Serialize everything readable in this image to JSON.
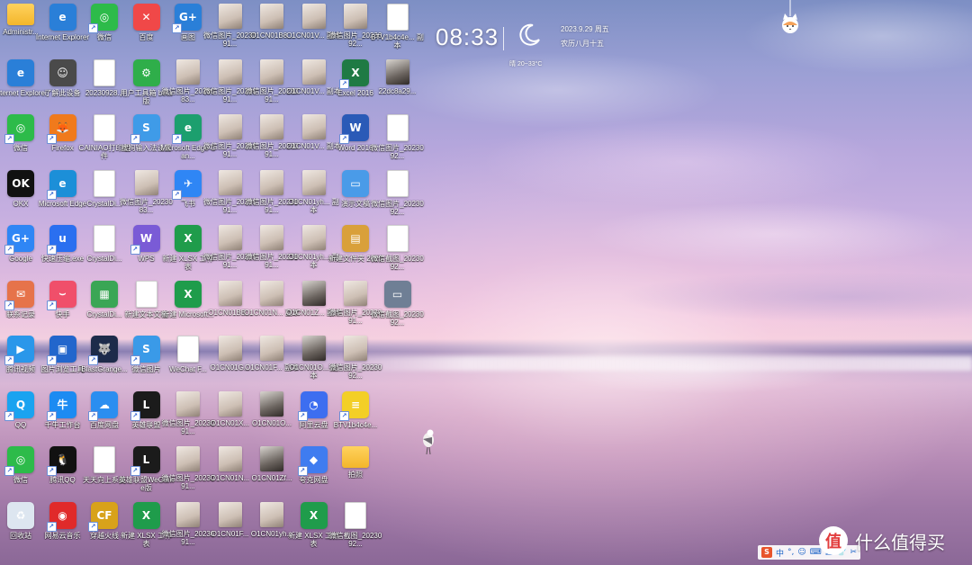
{
  "widget": {
    "time": "08:33",
    "date": "2023.9.29  周五",
    "lunar": "农历八月十五",
    "weather": "晴 20~33°C"
  },
  "brand": {
    "logo_glyph": "值",
    "text": "什么值得买"
  },
  "ime": {
    "logo": "S",
    "items": [
      "中",
      "°,",
      "☺",
      "⌨",
      "▤",
      "👕",
      "✂"
    ]
  },
  "icon_colors": {
    "blue": "#2f7de1",
    "green": "#1f9c4b",
    "red": "#e23c3c",
    "purple": "#7b4fd6",
    "orange": "#f08a24",
    "teal": "#17a5b8",
    "dark": "#2a2a2a",
    "pink": "#ef4f7d"
  },
  "columns": [
    [
      {
        "label": "Administr...",
        "kind": "folder",
        "color": "",
        "glyph": "",
        "shortcut": false
      },
      {
        "label": "Internet Explorer",
        "kind": "app",
        "color": "#2a7fd8",
        "glyph": "e",
        "shortcut": false
      },
      {
        "label": "微信",
        "kind": "app",
        "color": "#2dbb4a",
        "glyph": "◎",
        "shortcut": true
      },
      {
        "label": "OKX",
        "kind": "app",
        "color": "#111111",
        "glyph": "OK",
        "shortcut": false
      },
      {
        "label": "Google",
        "kind": "app",
        "color": "#2f86f5",
        "glyph": "G+",
        "shortcut": true
      },
      {
        "label": "联系记录",
        "kind": "app",
        "color": "#e6734a",
        "glyph": "✉",
        "shortcut": true
      },
      {
        "label": "腾讯视频",
        "kind": "app",
        "color": "#2a97ea",
        "glyph": "▶",
        "shortcut": true
      },
      {
        "label": "QQ",
        "kind": "app",
        "color": "#1aa3f0",
        "glyph": "Q",
        "shortcut": true
      },
      {
        "label": "微信",
        "kind": "app",
        "color": "#2dbb4a",
        "glyph": "◎",
        "shortcut": true
      },
      {
        "label": "回收站",
        "kind": "app",
        "color": "#dde6f0",
        "glyph": "♻",
        "shortcut": false
      }
    ],
    [
      {
        "label": "Internet Explorer",
        "kind": "app",
        "color": "#2a7fd8",
        "glyph": "e",
        "shortcut": false
      },
      {
        "label": "了解此设备",
        "kind": "app",
        "color": "#4a4a4a",
        "glyph": "☺",
        "shortcut": false
      },
      {
        "label": "Firefox",
        "kind": "app",
        "color": "#f07a1c",
        "glyph": "🦊",
        "shortcut": true
      },
      {
        "label": "Microsoft Edge",
        "kind": "app",
        "color": "#1c8fd8",
        "glyph": "e",
        "shortcut": true
      },
      {
        "label": "快速压缩.exe",
        "kind": "app",
        "color": "#2a6ff0",
        "glyph": "u",
        "shortcut": true
      },
      {
        "label": "快手",
        "kind": "app",
        "color": "#f04f6a",
        "glyph": "⌣",
        "shortcut": true
      },
      {
        "label": "图片浏览工具",
        "kind": "app",
        "color": "#2266cc",
        "glyph": "▣",
        "shortcut": true
      },
      {
        "label": "千牛工作台",
        "kind": "app",
        "color": "#1c8bf2",
        "glyph": "牛",
        "shortcut": true
      },
      {
        "label": "腾讯QQ",
        "kind": "app",
        "color": "#111111",
        "glyph": "🐧",
        "shortcut": true
      },
      {
        "label": "网易云音乐",
        "kind": "app",
        "color": "#e02a2a",
        "glyph": "◉",
        "shortcut": true
      }
    ],
    [
      {
        "label": "微信",
        "kind": "app",
        "color": "#2dbb4a",
        "glyph": "◎",
        "shortcut": true
      },
      {
        "label": "20230928...",
        "kind": "doc",
        "color": "",
        "glyph": "",
        "shortcut": false
      },
      {
        "label": "CAINIAO打印组件",
        "kind": "doc",
        "color": "",
        "glyph": "",
        "shortcut": false
      },
      {
        "label": "CrystalDi...",
        "kind": "doc",
        "color": "",
        "glyph": "",
        "shortcut": false
      },
      {
        "label": "CrystalDi...",
        "kind": "doc",
        "color": "",
        "glyph": "",
        "shortcut": false
      },
      {
        "label": "CrystalDi...",
        "kind": "app",
        "color": "#3aa655",
        "glyph": "▦",
        "shortcut": false
      },
      {
        "label": "BlastGrange...",
        "kind": "app",
        "color": "#1d2b4a",
        "glyph": "🐺",
        "shortcut": true
      },
      {
        "label": "百度网盘",
        "kind": "app",
        "color": "#2b8ef0",
        "glyph": "☁",
        "shortcut": true
      },
      {
        "label": "天天向上系统",
        "kind": "doc",
        "color": "",
        "glyph": "",
        "shortcut": false
      },
      {
        "label": "穿越火线",
        "kind": "app",
        "color": "#d8a21a",
        "glyph": "CF",
        "shortcut": true
      }
    ],
    [
      {
        "label": "百度",
        "kind": "app",
        "color": "#f04848",
        "glyph": "✕",
        "shortcut": false
      },
      {
        "label": "用户工具箱 beta版",
        "kind": "app",
        "color": "#2fae4a",
        "glyph": "⚙",
        "shortcut": false
      },
      {
        "label": "搜狗输入法设置",
        "kind": "app",
        "color": "#3f9be8",
        "glyph": "S",
        "shortcut": true
      },
      {
        "label": "微信图片_2023083...",
        "kind": "photo",
        "color": "",
        "glyph": "",
        "shortcut": false
      },
      {
        "label": "WPS",
        "kind": "app",
        "color": "#7a5bd6",
        "glyph": "W",
        "shortcut": true
      },
      {
        "label": "新建文本文档",
        "kind": "doc",
        "color": "",
        "glyph": "",
        "shortcut": false
      },
      {
        "label": "微信图片",
        "kind": "app",
        "color": "#3a9ae8",
        "glyph": "S",
        "shortcut": true
      },
      {
        "label": "英雄联盟",
        "kind": "app",
        "color": "#1b1b1b",
        "glyph": "L",
        "shortcut": true
      },
      {
        "label": "英雄联盟WeGame版",
        "kind": "app",
        "color": "#1b1b1b",
        "glyph": "L",
        "shortcut": true
      },
      {
        "label": "新建 XLSX 工作表",
        "kind": "app",
        "color": "#1f9c4b",
        "glyph": "X",
        "shortcut": false
      }
    ],
    [
      {
        "label": "画图",
        "kind": "app",
        "color": "#2a7fd8",
        "glyph": "G+",
        "shortcut": true
      },
      {
        "label": "微信图片_2023083...",
        "kind": "photo",
        "color": "",
        "glyph": "",
        "shortcut": false
      },
      {
        "label": "Microsoft Edge Can...",
        "kind": "app",
        "color": "#1c9f6e",
        "glyph": "e",
        "shortcut": true
      },
      {
        "label": "飞书",
        "kind": "app",
        "color": "#2f86f5",
        "glyph": "✈",
        "shortcut": true
      },
      {
        "label": "新建 XLSX 工作表",
        "kind": "app",
        "color": "#1f9c4b",
        "glyph": "X",
        "shortcut": false
      },
      {
        "label": "新建 Microsoft...",
        "kind": "app",
        "color": "#1f9c4b",
        "glyph": "X",
        "shortcut": false
      },
      {
        "label": "WeChat F...",
        "kind": "doc",
        "color": "",
        "glyph": "",
        "shortcut": false
      },
      {
        "label": "微信图片_2023091...",
        "kind": "photo",
        "color": "",
        "glyph": "",
        "shortcut": false
      },
      {
        "label": "微信图片_2023091...",
        "kind": "photo",
        "color": "",
        "glyph": "",
        "shortcut": false
      },
      {
        "label": "微信图片_2023091...",
        "kind": "photo",
        "color": "",
        "glyph": "",
        "shortcut": false
      }
    ],
    [
      {
        "label": "微信图片_2023091...",
        "kind": "photo",
        "color": "",
        "glyph": "",
        "shortcut": false
      },
      {
        "label": "微信图片_2023091...",
        "kind": "photo",
        "color": "",
        "glyph": "",
        "shortcut": false
      },
      {
        "label": "微信图片_2023091...",
        "kind": "photo",
        "color": "",
        "glyph": "",
        "shortcut": false
      },
      {
        "label": "微信图片_2023091...",
        "kind": "photo",
        "color": "",
        "glyph": "",
        "shortcut": false
      },
      {
        "label": "微信图片_2023091...",
        "kind": "photo",
        "color": "",
        "glyph": "",
        "shortcut": false
      },
      {
        "label": "O1CN01BB...",
        "kind": "photo",
        "color": "",
        "glyph": "",
        "shortcut": false
      },
      {
        "label": "O1CN01G...",
        "kind": "photo",
        "color": "",
        "glyph": "",
        "shortcut": false
      },
      {
        "label": "O1CN01X...",
        "kind": "photo",
        "color": "",
        "glyph": "",
        "shortcut": false
      },
      {
        "label": "O1CN01N...",
        "kind": "photo",
        "color": "",
        "glyph": "",
        "shortcut": false
      },
      {
        "label": "O1CN01F...",
        "kind": "photo",
        "color": "",
        "glyph": "",
        "shortcut": false
      }
    ],
    [
      {
        "label": "O1CN01B8...",
        "kind": "photo",
        "color": "",
        "glyph": "",
        "shortcut": false
      },
      {
        "label": "微信图片_2023091...",
        "kind": "photo",
        "color": "",
        "glyph": "",
        "shortcut": false
      },
      {
        "label": "微信图片_2023091...",
        "kind": "photo",
        "color": "",
        "glyph": "",
        "shortcut": false
      },
      {
        "label": "微信图片_2023091...",
        "kind": "photo",
        "color": "",
        "glyph": "",
        "shortcut": false
      },
      {
        "label": "微信图片_2023091...",
        "kind": "photo",
        "color": "",
        "glyph": "",
        "shortcut": false
      },
      {
        "label": "O1CN01N... 副本",
        "kind": "photo",
        "color": "",
        "glyph": "",
        "shortcut": false
      },
      {
        "label": "O1CN01F... 副本",
        "kind": "photo",
        "color": "",
        "glyph": "",
        "shortcut": false
      },
      {
        "label": "O1CN01O...",
        "kind": "photo-dark",
        "color": "",
        "glyph": "",
        "shortcut": false
      },
      {
        "label": "O1CN01Zf...",
        "kind": "photo-dark",
        "color": "",
        "glyph": "",
        "shortcut": false
      },
      {
        "label": "O1CN01yh...",
        "kind": "photo",
        "color": "",
        "glyph": "",
        "shortcut": false
      }
    ],
    [
      {
        "label": "O1CN01V... 副本",
        "kind": "photo",
        "color": "",
        "glyph": "",
        "shortcut": false
      },
      {
        "label": "O1CN01V... 副本",
        "kind": "photo",
        "color": "",
        "glyph": "",
        "shortcut": false
      },
      {
        "label": "O1CN01V... 副本",
        "kind": "photo",
        "color": "",
        "glyph": "",
        "shortcut": false
      },
      {
        "label": "O1CN01yh... 副本",
        "kind": "photo",
        "color": "",
        "glyph": "",
        "shortcut": false
      },
      {
        "label": "O1CN01yh... 副本",
        "kind": "photo",
        "color": "",
        "glyph": "",
        "shortcut": false
      },
      {
        "label": "O1CN01Z... 副本",
        "kind": "photo-dark",
        "color": "",
        "glyph": "",
        "shortcut": false
      },
      {
        "label": "O1CN01O... 副本",
        "kind": "photo-dark",
        "color": "",
        "glyph": "",
        "shortcut": false
      },
      {
        "label": "阿里云盘",
        "kind": "app",
        "color": "#3d6ef0",
        "glyph": "◔",
        "shortcut": true
      },
      {
        "label": "夸克网盘",
        "kind": "app",
        "color": "#3f7cf0",
        "glyph": "◆",
        "shortcut": true
      },
      {
        "label": "新建 XLSX 工作表",
        "kind": "app",
        "color": "#1f9c4b",
        "glyph": "X",
        "shortcut": false
      }
    ],
    [
      {
        "label": "微信图片_2023092...",
        "kind": "photo",
        "color": "",
        "glyph": "",
        "shortcut": false
      },
      {
        "label": "Excel 2016",
        "kind": "app",
        "color": "#1f7a44",
        "glyph": "X",
        "shortcut": true
      },
      {
        "label": "Word 2016",
        "kind": "app",
        "color": "#2a5ab7",
        "glyph": "W",
        "shortcut": true
      },
      {
        "label": "演示文稿",
        "kind": "app",
        "color": "#4a9be8",
        "glyph": "▭",
        "shortcut": false
      },
      {
        "label": "新建文件夹 2023",
        "kind": "app",
        "color": "#d9a03a",
        "glyph": "▤",
        "shortcut": false
      },
      {
        "label": "微信图片_2023091...",
        "kind": "photo",
        "color": "",
        "glyph": "",
        "shortcut": false
      },
      {
        "label": "微信图片_2023092...",
        "kind": "photo",
        "color": "",
        "glyph": "",
        "shortcut": false
      },
      {
        "label": "BTV1b4c4e...",
        "kind": "app",
        "color": "#f3cf26",
        "glyph": "≡",
        "shortcut": true
      },
      {
        "label": "拍照",
        "kind": "folder",
        "color": "",
        "glyph": "",
        "shortcut": false
      },
      {
        "label": "微信截图_2023092...",
        "kind": "doc",
        "color": "",
        "glyph": "",
        "shortcut": false
      }
    ],
    [
      {
        "label": "BTV1b4c4e... 副本",
        "kind": "doc",
        "color": "",
        "glyph": "",
        "shortcut": false
      },
      {
        "label": "22dc8a29...",
        "kind": "photo-dark",
        "color": "",
        "glyph": "",
        "shortcut": false
      },
      {
        "label": "微信图片_2023092...",
        "kind": "doc",
        "color": "",
        "glyph": "",
        "shortcut": false
      },
      {
        "label": "微信图片_2023092...",
        "kind": "doc",
        "color": "",
        "glyph": "",
        "shortcut": false
      },
      {
        "label": "微信截图_2023092...",
        "kind": "doc",
        "color": "",
        "glyph": "",
        "shortcut": false
      },
      {
        "label": "微信截图_2023092...",
        "kind": "app",
        "color": "#6f7f95",
        "glyph": "▭",
        "shortcut": false
      }
    ]
  ]
}
